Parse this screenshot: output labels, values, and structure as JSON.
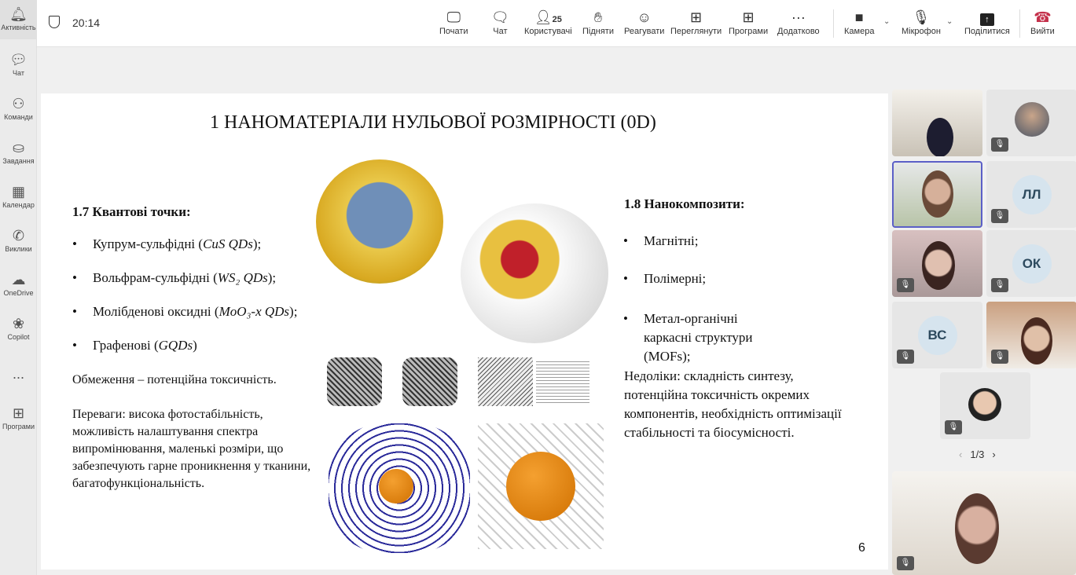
{
  "sidebar": {
    "items": [
      {
        "label": "Активність",
        "icon": "bell-icon"
      },
      {
        "label": "Чат",
        "icon": "chat-icon"
      },
      {
        "label": "Команди",
        "icon": "teams-icon"
      },
      {
        "label": "Завдання",
        "icon": "assignments-icon"
      },
      {
        "label": "Календар",
        "icon": "calendar-icon"
      },
      {
        "label": "Виклики",
        "icon": "phone-icon"
      },
      {
        "label": "OneDrive",
        "icon": "cloud-icon"
      },
      {
        "label": "Copilot",
        "icon": "copilot-icon"
      },
      {
        "label": "...",
        "icon": "more-icon"
      },
      {
        "label": "Програми",
        "icon": "apps-icon"
      }
    ]
  },
  "meeting": {
    "time": "20:14",
    "participants_count": "25"
  },
  "toolbar": {
    "start": "Почати",
    "chat": "Чат",
    "people": "Користувачі",
    "raise": "Підняти",
    "react": "Реагувати",
    "view": "Переглянути",
    "apps": "Програми",
    "more": "Додатково",
    "camera": "Камера",
    "mic": "Мікрофон",
    "share": "Поділитися",
    "leave": "Вийти"
  },
  "slide": {
    "title": "1 НАНОМАТЕРІАЛИ НУЛЬОВОЇ РОЗМІРНОСТІ (0D)",
    "left_heading": "1.7 Квантові точки:",
    "left_items": [
      {
        "text": "Купрум-сульфідні (",
        "em": "CuS QDs",
        "end": ");"
      },
      {
        "text": "Вольфрам-сульфідні (",
        "em": "WS₂ QDs",
        "end": ");"
      },
      {
        "text": "Молібденові оксидні (",
        "em": "MoO₃-x QDs",
        "end": ");"
      },
      {
        "text": "Графенові (",
        "em": "GQDs",
        "end": ")"
      }
    ],
    "limitation": "Обмеження – потенційна токсичність.",
    "advantages": "Переваги: висока фотостабільність, можливість налаштування спектра випромінювання, маленькі розміри, що забезпечують гарне проникнення у тканини, багатофункціональність.",
    "right_heading": "1.8 Нанокомпозити:",
    "right_items": [
      "Магнітні;",
      "Полімерні;",
      "Метал-органічні каркасні структури (MOFs);"
    ],
    "drawbacks": "Недоліки: складність синтезу, потенційна токсичність окремих компонентів, необхідність оптимізації стабільності та біосумісності.",
    "page_number": "6"
  },
  "participants": {
    "initials": [
      "ЛЛ",
      "ОК",
      "ВС"
    ],
    "pager": "1/3"
  },
  "colors": {
    "leave": "#c4314b",
    "selected": "#5b5fc7"
  }
}
